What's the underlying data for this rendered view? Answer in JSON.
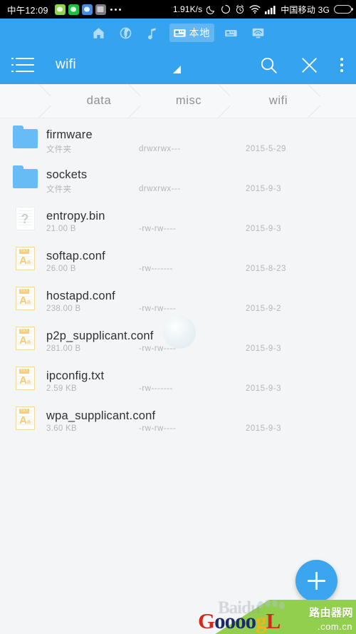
{
  "status_bar": {
    "time": "中午12:09",
    "app_icons": [
      "green-app-icon",
      "wechat-icon",
      "cloud-app-icon",
      "gallery-app-icon"
    ],
    "more_dots": "…",
    "network_speed": "1.91K/s",
    "icons": [
      "moon-icon",
      "sync-icon",
      "alarm-clock-icon",
      "wifi-icon",
      "signal-bars-icon"
    ],
    "carrier": "中国移动",
    "network_type": "3G",
    "battery": "battery-icon"
  },
  "tab_bar": {
    "items": [
      {
        "icon": "home-icon",
        "label": "",
        "active": false
      },
      {
        "icon": "globe-icon",
        "label": "",
        "active": false
      },
      {
        "icon": "music-note-icon",
        "label": "",
        "active": false
      },
      {
        "icon": "device-icon",
        "label": "本地",
        "active": true
      },
      {
        "icon": "device-secondary-icon",
        "label": "",
        "active": false
      },
      {
        "icon": "remote-screen-icon",
        "label": "",
        "active": false
      }
    ]
  },
  "toolbar": {
    "menu_icon": "list-menu-icon",
    "title": "wifi",
    "marker_icon": "triangle-marker-icon",
    "search_icon": "search-icon",
    "close_icon": "close-icon",
    "overflow_icon": "overflow-menu-icon"
  },
  "breadcrumb": {
    "items": [
      "",
      "data",
      "misc",
      "wifi"
    ]
  },
  "colors": {
    "accent": "#36a3f0",
    "folder": "#68bcf5",
    "txt_icon": "#f9cb6b",
    "fab": "#3ba5ef",
    "list_bg": "#f4f5f7",
    "filename": "#2e3135",
    "meta_text": "#b2b7bd",
    "watermark_green": "#93cf4e"
  },
  "files": [
    {
      "name": "firmware",
      "type": "folder",
      "size": "文件夹",
      "permissions": "drwxrwx---",
      "date": "2015-5-29"
    },
    {
      "name": "sockets",
      "type": "folder",
      "size": "文件夹",
      "permissions": "drwxrwx---",
      "date": "2015-9-3"
    },
    {
      "name": "entropy.bin",
      "type": "unknown",
      "size": "21.00 B",
      "permissions": "-rw-rw----",
      "date": "2015-9-3"
    },
    {
      "name": "softap.conf",
      "type": "txt",
      "size": "26.00 B",
      "permissions": "-rw-------",
      "date": "2015-8-23"
    },
    {
      "name": "hostapd.conf",
      "type": "txt",
      "size": "238.00 B",
      "permissions": "-rw-rw----",
      "date": "2015-9-2"
    },
    {
      "name": "p2p_supplicant.conf",
      "type": "txt",
      "size": "281.00 B",
      "permissions": "-rw-rw----",
      "date": "2015-9-3"
    },
    {
      "name": "ipconfig.txt",
      "type": "txt",
      "size": "2.59 KB",
      "permissions": "-rw-------",
      "date": "2015-9-3"
    },
    {
      "name": "wpa_supplicant.conf",
      "type": "txt",
      "size": "3.60 KB",
      "permissions": "-rw-rw----",
      "date": "2015-9-3"
    }
  ],
  "fab": {
    "icon": "plus-icon",
    "label": "+"
  },
  "watermark": {
    "baidu_text": "Baidu",
    "logo_g": "G",
    "logo_oooo": "oooo",
    "logo_g2": "g",
    "logo_l": "L",
    "site_cn": "路由器网",
    "domain": ".com.cn"
  },
  "txt_icon_labels": {
    "tag": "TXT",
    "letters": "A",
    "letters_small": "a",
    "question": "?"
  }
}
